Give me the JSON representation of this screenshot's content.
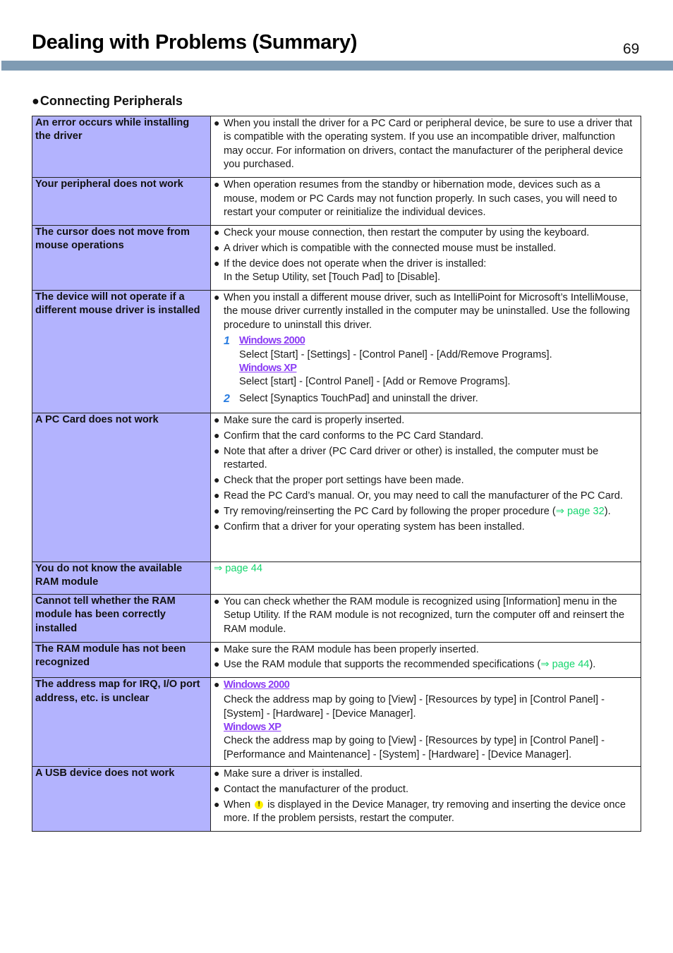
{
  "header": {
    "title": "Dealing with Problems (Summary)",
    "page_number": "69"
  },
  "section": {
    "bullet_icon": "filled-circle",
    "title": "Connecting Peripherals"
  },
  "colors": {
    "problem_cell_bg": "#b3b3fe",
    "header_band": "#7f9bb3",
    "os_link": "#8b3cf5",
    "page_ref": "#16d66e",
    "step_number": "#2a7de1"
  },
  "rows": [
    {
      "problem": "An error occurs while installing the driver",
      "items": [
        "When you install the driver for a PC Card or peripheral device, be sure to use a driver that is compatible with the operating system. If you use an incompatible driver, malfunction may occur. For information on drivers, contact the manufacturer of the peripheral device you purchased."
      ]
    },
    {
      "problem": "Your peripheral does not work",
      "items": [
        "When operation resumes from the standby or hibernation mode, devices such as a mouse, modem or PC Cards may not function properly. In such cases, you will need to restart your computer or reinitialize the individual devices."
      ]
    },
    {
      "problem": "The cursor does not move from mouse operations",
      "items": [
        "Check your mouse connection, then restart the computer by using the keyboard.",
        "A driver which is compatible with the connected mouse must be installed.",
        "If the device does not operate when the driver is installed:"
      ],
      "item3_line2": "In the Setup Utility, set [Touch Pad] to [Disable]."
    },
    {
      "problem": "The device will not operate if a different mouse driver is installed",
      "items": [
        "When you install a different mouse driver, such as IntelliPoint for Microsoft’s IntelliMouse, the mouse driver currently installed in the computer may be uninstalled. Use the following procedure to uninstall this driver."
      ],
      "steps": [
        {
          "number": "1",
          "os1": "Windows 2000",
          "text1": "Select [Start] - [Settings] - [Control Panel] - [Add/Remove Programs].",
          "os2": "Windows XP",
          "text2": "Select [start] - [Control Panel] - [Add or Remove Programs]."
        },
        {
          "number": "2",
          "text": "Select [Synaptics TouchPad] and uninstall the driver."
        }
      ]
    },
    {
      "problem": "A PC Card does not work",
      "items": [
        "Make sure the card is properly inserted.",
        "Confirm that the card conforms to the PC Card Standard.",
        "Note that after a driver (PC Card driver or other) is installed, the computer must be restarted.",
        "Check that the proper port settings have been made.",
        "Read the PC Card’s manual. Or, you may need to call the manufacturer of the PC Card.",
        "Try removing/reinserting the PC Card by following the proper procedure (",
        "Confirm that a driver for your operating system has been installed."
      ],
      "ref": "⇒ page 32",
      "ref_after": ")."
    },
    {
      "problem": "You do not know the available RAM module",
      "ref": "⇒ page 44"
    },
    {
      "problem": "Cannot tell whether the RAM module has been correctly installed",
      "items": [
        "You can check whether the RAM module is recognized using [Information] menu in the Setup Utility. If the RAM module is not recognized, turn the computer off and reinsert the RAM module."
      ]
    },
    {
      "problem": "The RAM module has not been recognized",
      "items": [
        "Make sure the RAM module has been properly inserted.",
        "Use the RAM module that supports the recommended specifications ("
      ],
      "ref": "⇒ page 44",
      "ref_after": ")."
    },
    {
      "problem": "The address map for IRQ, I/O port address, etc. is unclear",
      "os1": "Windows 2000",
      "text1": "Check the address map by going to [View] - [Resources by type] in [Control Panel] - [System] - [Hardware] - [Device Manager].",
      "os2": "Windows XP",
      "text2": "Check the address map by going to [View] - [Resources by type] in [Control Panel] - [Performance and Maintenance] - [System] - [Hardware] - [Device Manager]."
    },
    {
      "problem": "A USB device does not work",
      "items": [
        "Make sure a driver is installed.",
        "Contact the manufacturer of the product.",
        "When",
        "is displayed in the Device Manager, try removing and inserting the device once more. If the problem persists, restart the computer."
      ],
      "warning_icon": "!"
    }
  ]
}
